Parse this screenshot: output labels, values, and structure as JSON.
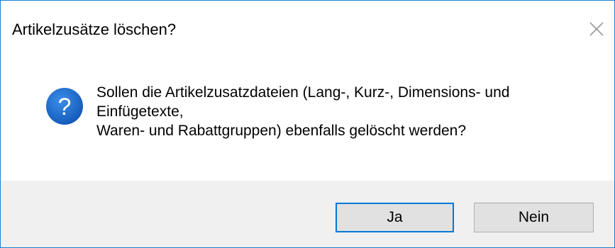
{
  "dialog": {
    "title": "Artikelzusätze löschen?",
    "close_icon": "close-icon",
    "icon": "question-icon",
    "icon_glyph": "?",
    "message_lines": [
      "Sollen die Artikelzusatzdateien (Lang-, Kurz-, Dimensions- und",
      "Einfügetexte,",
      "Waren- und Rabattgruppen) ebenfalls gelöscht werden?"
    ],
    "buttons": {
      "yes_label": "Ja",
      "no_label": "Nein"
    },
    "colors": {
      "accent": "#0078d7",
      "icon_fill": "#1e64c8",
      "footer_bg": "#f0f0f0",
      "button_bg": "#e1e1e1"
    }
  }
}
